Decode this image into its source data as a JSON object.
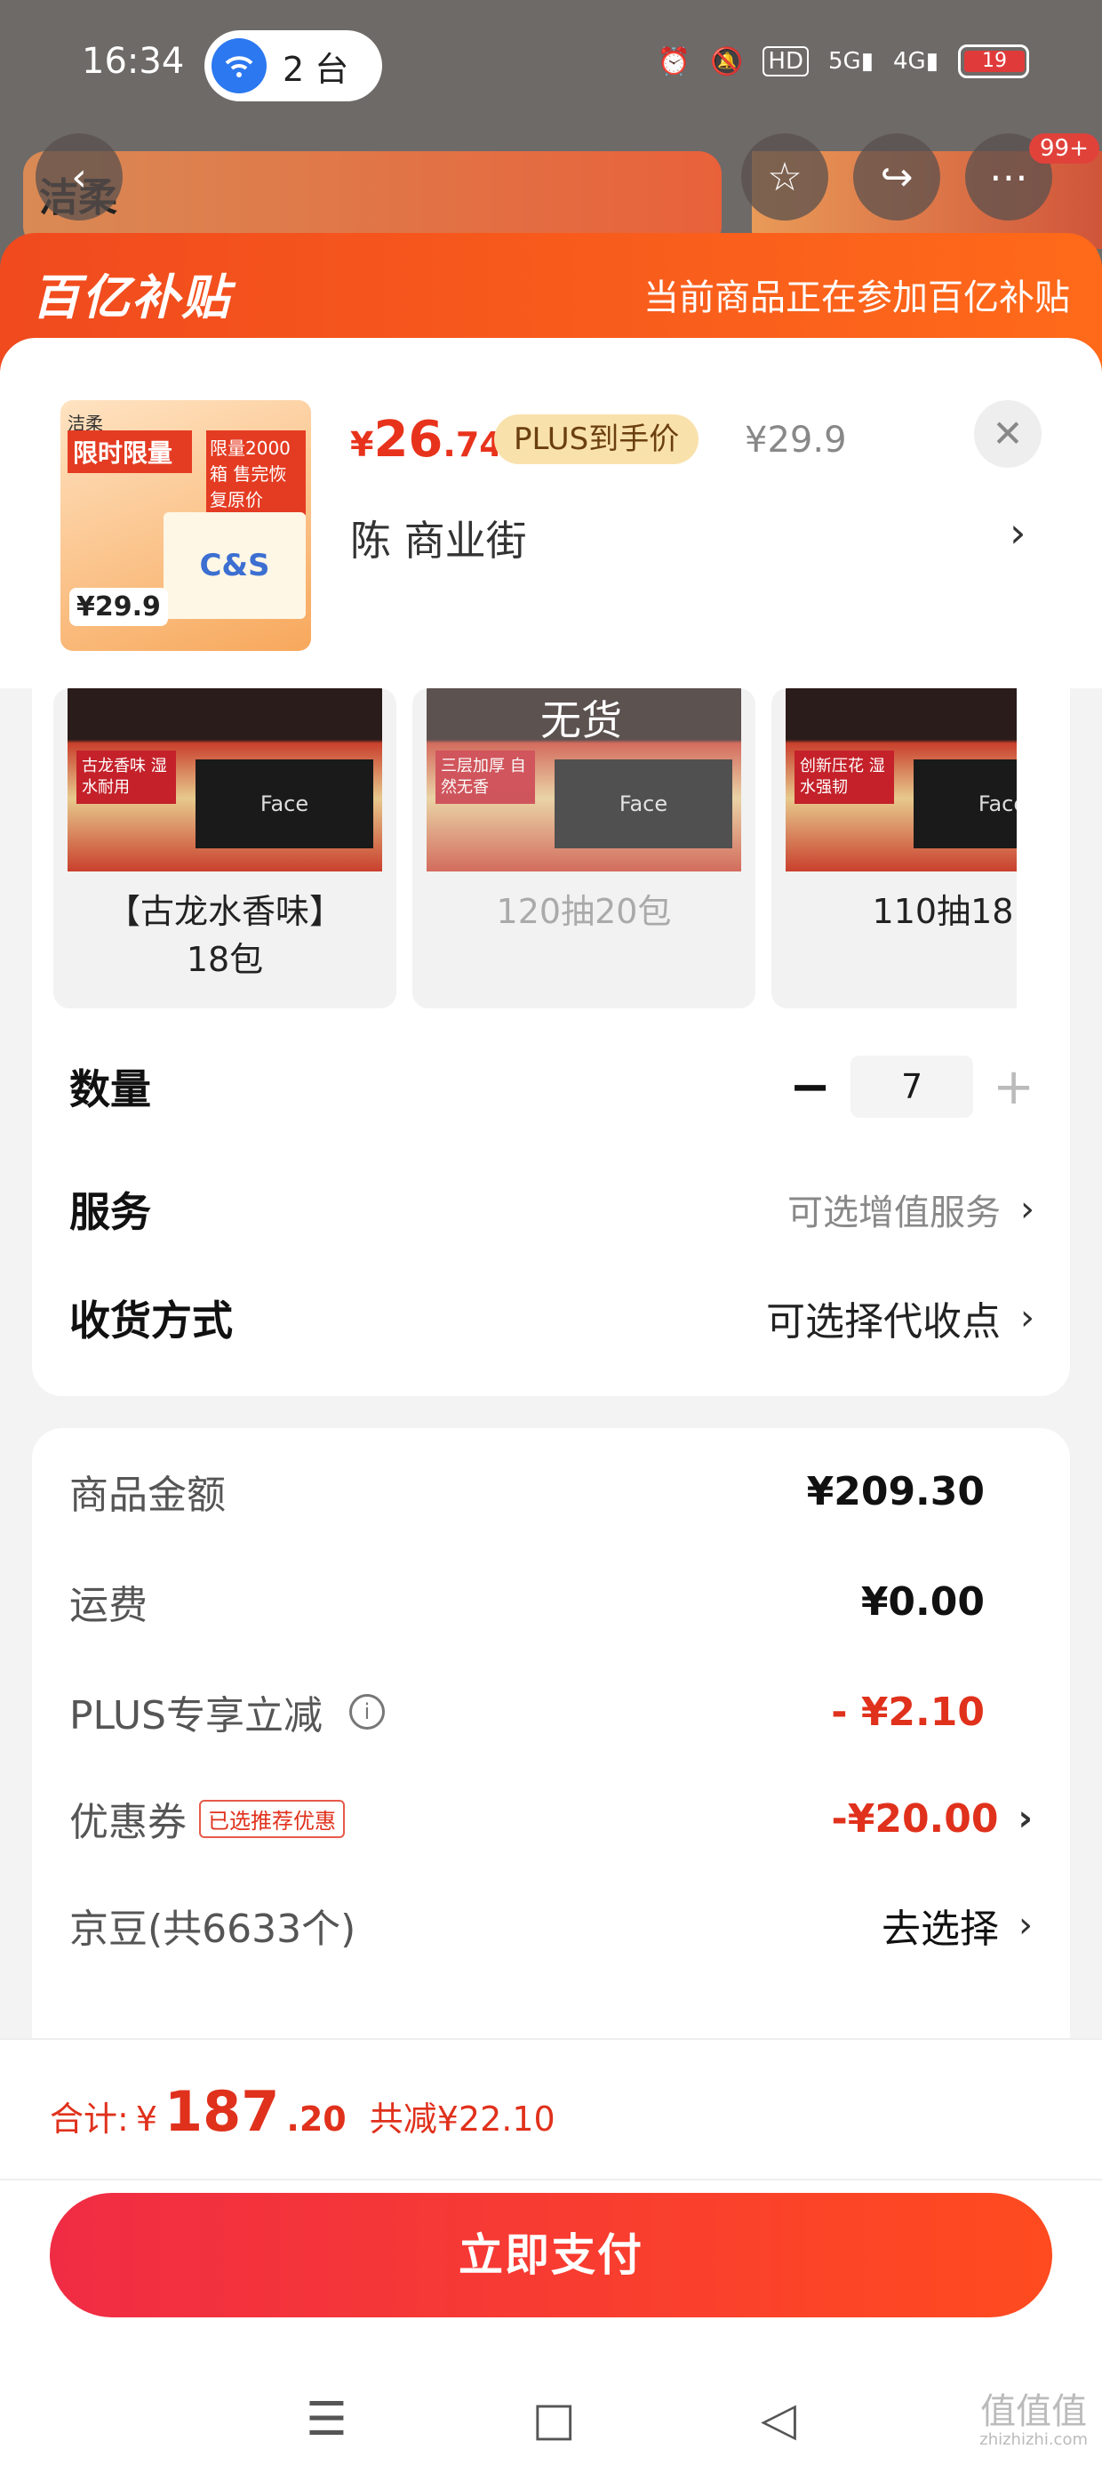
{
  "status_bar": {
    "time": "16:34",
    "hotspot_icon": "wifi-hotspot-icon",
    "hotspot_count": "2 台",
    "icons": [
      "alarm-icon",
      "mute-icon",
      "hd-icon",
      "5g-signal-icon",
      "4g-signal-icon"
    ],
    "battery": "19"
  },
  "background_page": {
    "logo": "洁柔",
    "cart_badge": "99+"
  },
  "sheet_header": {
    "brand": "百亿补贴",
    "note": "当前商品正在参加百亿补贴"
  },
  "product": {
    "thumb": {
      "brand": "洁柔",
      "promo": "限时限量",
      "tag": "限量2000箱 售完恢复原价",
      "box_text": "C&S",
      "price": "¥29.9"
    },
    "price_symbol": "¥",
    "price_int": "26",
    "price_dec": ".74",
    "plus_tag": "PLUS到手价",
    "original_price": "¥29.9",
    "address": "陈  商业街"
  },
  "specs": [
    {
      "name": "【古龙水香味】\n18包",
      "label": "古龙香味 湿水耐用",
      "tissue": "Face",
      "disabled": false
    },
    {
      "name": "120抽20包",
      "label": "三层加厚 自然无香",
      "tissue": "Face",
      "disabled": true,
      "stock": "无货"
    },
    {
      "name": "110抽18",
      "label": "创新压花 湿水强韧",
      "tissue": "Face",
      "disabled": false
    }
  ],
  "rows": {
    "quantity_label": "数量",
    "quantity_value": "7",
    "minus": "−",
    "plus": "+",
    "service_label": "服务",
    "service_value": "可选增值服务",
    "delivery_label": "收货方式",
    "delivery_value": "可选择代收点"
  },
  "breakdown": {
    "amount_label": "商品金额",
    "amount_value": "¥209.30",
    "shipping_label": "运费",
    "shipping_value": "¥0.00",
    "plus_label": "PLUS专享立减",
    "plus_value": "- ¥2.10",
    "coupon_label": "优惠券",
    "coupon_tag": "已选推荐优惠",
    "coupon_value": "-¥20.00",
    "jd_label": "京豆(共6633个)",
    "jd_value": "去选择"
  },
  "footer": {
    "total_label": "合计:",
    "total_symbol": "¥",
    "total_int": "187",
    "total_dec": ".20",
    "saved": "共减¥22.10",
    "pay_button": "立即支付"
  },
  "nav": [
    "menu-icon",
    "home-square-icon",
    "back-triangle-icon"
  ],
  "watermark": {
    "text": "值值值",
    "url": "zhizhizhi.com"
  }
}
